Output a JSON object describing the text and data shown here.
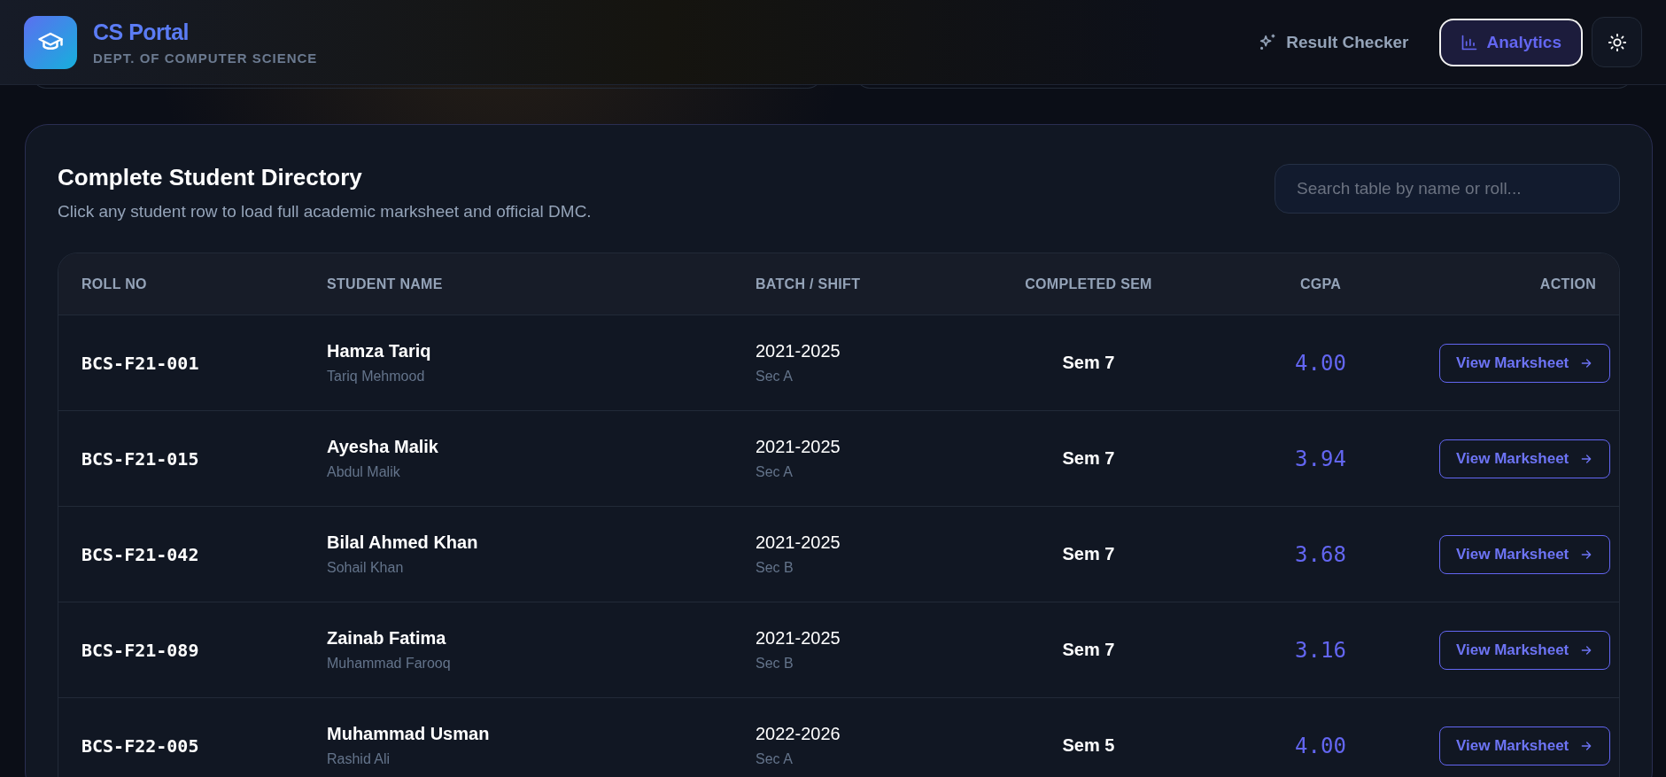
{
  "header": {
    "title": "CS Portal",
    "subtitle": "DEPT. OF COMPUTER SCIENCE",
    "nav": [
      {
        "label": "Result Checker",
        "kind": "sparkle",
        "selected": false
      },
      {
        "label": "Analytics",
        "kind": "chart",
        "selected": true
      }
    ]
  },
  "directory": {
    "title": "Complete Student Directory",
    "description": "Click any student row to load full academic marksheet and official DMC.",
    "search": {
      "placeholder": "Search table by name or roll..."
    },
    "table": {
      "columns": [
        "ROLL NO",
        "STUDENT NAME",
        "BATCH / SHIFT",
        "COMPLETED SEM",
        "CGPA",
        "ACTION"
      ],
      "rows": [
        {
          "roll": "BCS-F21-001",
          "name": "Hamza Tariq",
          "guardian": "Tariq Mehmood",
          "batch": "2021-2025",
          "section": "Sec A",
          "semester": "Sem 7",
          "cgpa": "4.00",
          "action": "View Marksheet"
        },
        {
          "roll": "BCS-F21-015",
          "name": "Ayesha Malik",
          "guardian": "Abdul Malik",
          "batch": "2021-2025",
          "section": "Sec A",
          "semester": "Sem 7",
          "cgpa": "3.94",
          "action": "View Marksheet"
        },
        {
          "roll": "BCS-F21-042",
          "name": "Bilal Ahmed Khan",
          "guardian": "Sohail Khan",
          "batch": "2021-2025",
          "section": "Sec B",
          "semester": "Sem 7",
          "cgpa": "3.68",
          "action": "View Marksheet"
        },
        {
          "roll": "BCS-F21-089",
          "name": "Zainab Fatima",
          "guardian": "Muhammad Farooq",
          "batch": "2021-2025",
          "section": "Sec B",
          "semester": "Sem 7",
          "cgpa": "3.16",
          "action": "View Marksheet"
        },
        {
          "roll": "BCS-F22-005",
          "name": "Muhammad Usman",
          "guardian": "Rashid Ali",
          "batch": "2022-2026",
          "section": "Sec A",
          "semester": "Sem 5",
          "cgpa": "4.00",
          "action": "View Marksheet"
        }
      ]
    }
  }
}
